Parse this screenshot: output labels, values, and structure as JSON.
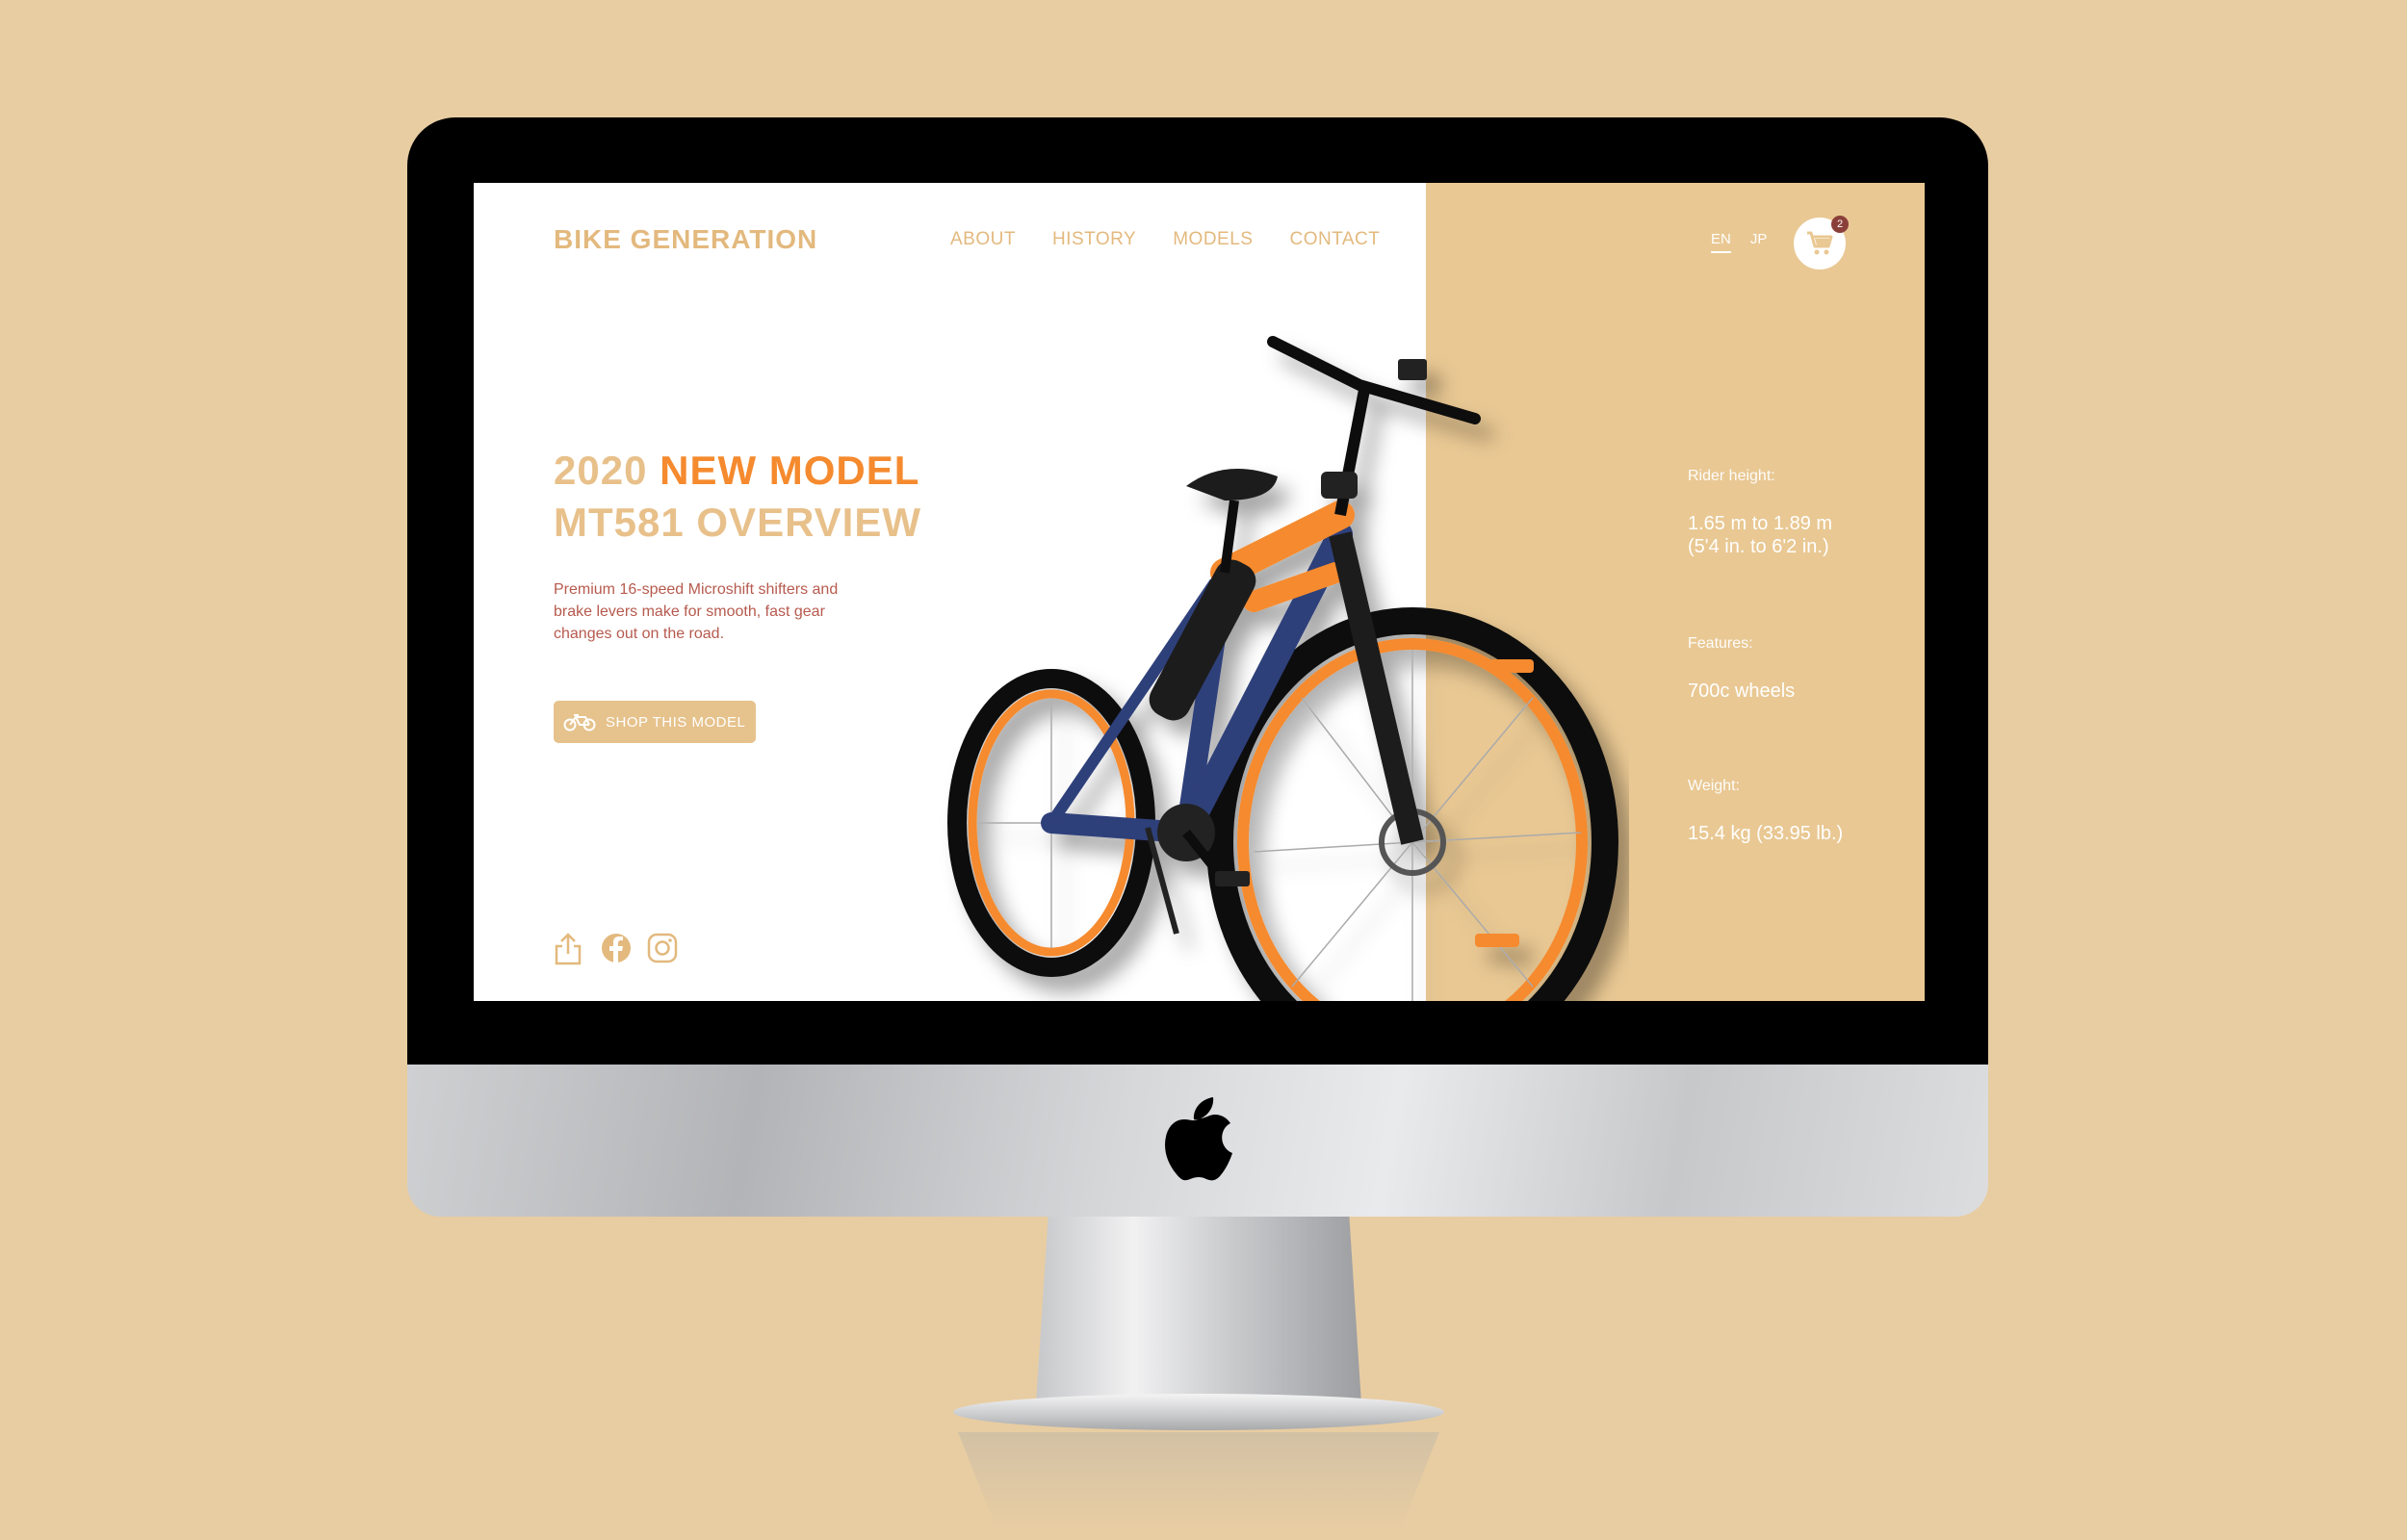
{
  "site": {
    "brand": "BIKE GENERATION",
    "nav": [
      "ABOUT",
      "HISTORY",
      "MODELS",
      "CONTACT"
    ],
    "languages": [
      {
        "label": "EN",
        "active": true
      },
      {
        "label": "JP",
        "active": false
      }
    ],
    "cart_count": "2"
  },
  "hero": {
    "title_prefix": "2020",
    "title_highlight": "NEW MODEL",
    "title_line2": "MT581 OVERVIEW",
    "description": "Premium 16-speed Microshift shifters and brake levers make for smooth, fast gear changes out on the road.",
    "cta_label": "SHOP THIS MODEL"
  },
  "social_icons": [
    "share-icon",
    "facebook-icon",
    "instagram-icon"
  ],
  "specs": [
    {
      "label": "Rider height:",
      "value_line1": "1.65 m to 1.89 m",
      "value_line2": "(5'4 in. to 6'2 in.)"
    },
    {
      "label": "Features:",
      "value_line1": "700c wheels",
      "value_line2": ""
    },
    {
      "label": "Weight:",
      "value_line1": "15.4 kg (33.95 lb.)",
      "value_line2": ""
    }
  ],
  "colors": {
    "background": "#e8cda2",
    "panel": "#e9c893",
    "accent": "#f58a2e",
    "brand_text": "#e3b97e",
    "description_text": "#b65a4e",
    "button": "#e6c28c",
    "bike_frame": "#2f3f7a"
  }
}
